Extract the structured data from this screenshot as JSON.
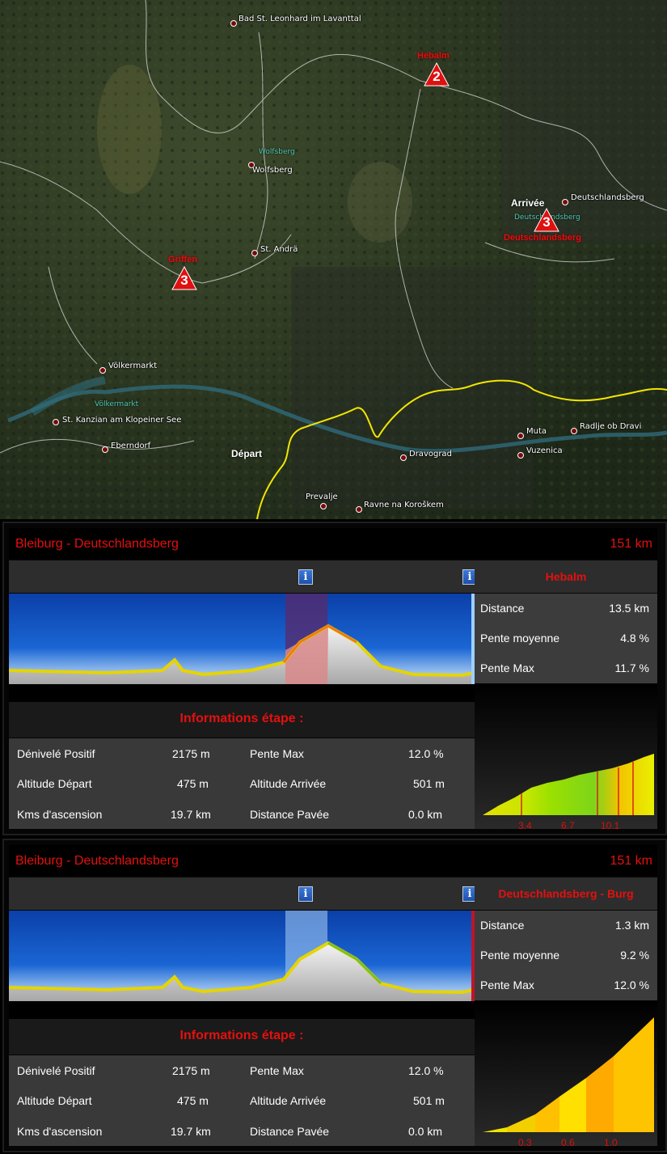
{
  "map": {
    "places": [
      {
        "name": "Bad St. Leonhard im Lavanttal"
      },
      {
        "name": "Wolfsberg"
      },
      {
        "name": "St. Andrä"
      },
      {
        "name": "Deutschlandsberg"
      },
      {
        "name": "Völkermarkt"
      },
      {
        "name": "St. Kanzian am Klopeiner See"
      },
      {
        "name": "Eberndorf"
      },
      {
        "name": "Dravograd"
      },
      {
        "name": "Prevalje"
      },
      {
        "name": "Ravne na Koroškem"
      },
      {
        "name": "Muta"
      },
      {
        "name": "Vuzenica"
      },
      {
        "name": "Radlje ob Dravi"
      }
    ],
    "water_labels": [
      "Wolfsberg",
      "Völkermarkt",
      "Deutschlandsberg"
    ],
    "start_label": "Départ",
    "finish_label": "Arrivée",
    "climbs": [
      {
        "category": "2",
        "name": "Hebalm"
      },
      {
        "category": "3",
        "name": "Griffen"
      },
      {
        "category": "3",
        "name": "Deutschlandsberg"
      }
    ],
    "border_color": "#f2e600",
    "marker_color": "#e01010"
  },
  "panels": [
    {
      "title": "Bleiburg - Deutschlandsberg",
      "distance": "151 km",
      "climb_name": "Hebalm",
      "climb_stats": [
        {
          "label": "Distance",
          "value": "13.5 km"
        },
        {
          "label": "Pente moyenne",
          "value": "4.8 %"
        },
        {
          "label": "Pente Max",
          "value": "11.7 %"
        }
      ],
      "mini_ticks": [
        "3.4",
        "6.7",
        "10.1"
      ],
      "etape_heading": "Informations étape :",
      "etape": [
        {
          "label": "Dénivelé Positif",
          "value": "2175 m"
        },
        {
          "label": "Pente Max",
          "value": "12.0 %"
        },
        {
          "label": "Altitude Départ",
          "value": "475 m"
        },
        {
          "label": "Altitude Arrivée",
          "value": "501 m"
        },
        {
          "label": "Kms d'ascension",
          "value": "19.7 km"
        },
        {
          "label": "Distance Pavée",
          "value": "0.0 km"
        }
      ]
    },
    {
      "title": "Bleiburg - Deutschlandsberg",
      "distance": "151 km",
      "climb_name": "Deutschlandsberg - Burg",
      "climb_stats": [
        {
          "label": "Distance",
          "value": "1.3 km"
        },
        {
          "label": "Pente moyenne",
          "value": "9.2 %"
        },
        {
          "label": "Pente Max",
          "value": "12.0 %"
        }
      ],
      "mini_ticks": [
        "0.3",
        "0.6",
        "1.0"
      ],
      "etape_heading": "Informations étape :",
      "etape": [
        {
          "label": "Dénivelé Positif",
          "value": "2175 m"
        },
        {
          "label": "Pente Max",
          "value": "12.0 %"
        },
        {
          "label": "Altitude Départ",
          "value": "475 m"
        },
        {
          "label": "Altitude Arrivée",
          "value": "501 m"
        },
        {
          "label": "Kms d'ascension",
          "value": "19.7 km"
        },
        {
          "label": "Distance Pavée",
          "value": "0.0 km"
        }
      ]
    }
  ]
}
